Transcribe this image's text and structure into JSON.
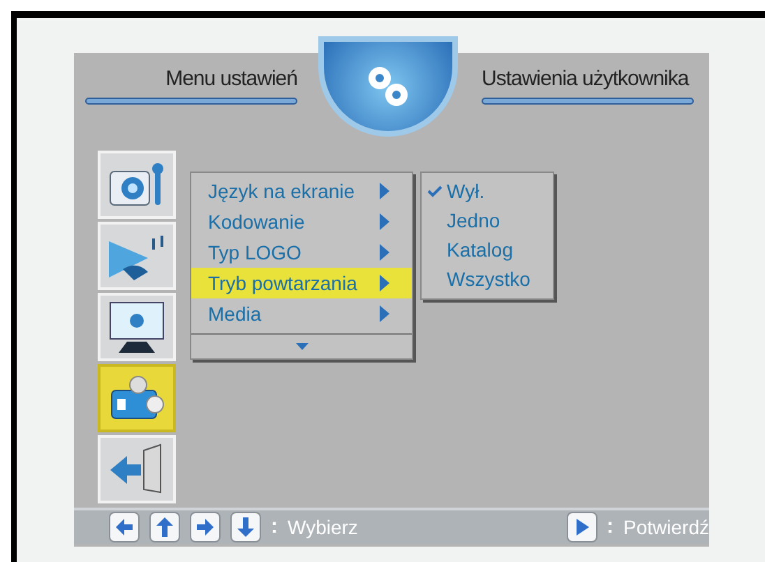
{
  "header": {
    "left_title": "Menu ustawień",
    "right_title": "Ustawienia użytkownika"
  },
  "sidebar": {
    "items": [
      {
        "kind": "camera",
        "selected": false
      },
      {
        "kind": "speaker",
        "selected": false
      },
      {
        "kind": "monitor",
        "selected": false
      },
      {
        "kind": "toolbox",
        "selected": true
      },
      {
        "kind": "exit",
        "selected": false
      }
    ]
  },
  "menu": {
    "items": [
      {
        "label": "Język na ekranie",
        "selected": false
      },
      {
        "label": "Kodowanie",
        "selected": false
      },
      {
        "label": "Typ LOGO",
        "selected": false
      },
      {
        "label": "Tryb powtarzania",
        "selected": true
      },
      {
        "label": "Media",
        "selected": false
      }
    ]
  },
  "submenu": {
    "items": [
      {
        "label": "Wył.",
        "checked": true
      },
      {
        "label": "Jedno",
        "checked": false
      },
      {
        "label": "Katalog",
        "checked": false
      },
      {
        "label": "Wszystko",
        "checked": false
      }
    ]
  },
  "footer": {
    "hints": [
      {
        "keys": [
          {
            "kind": "left"
          },
          {
            "kind": "up"
          },
          {
            "kind": "right"
          },
          {
            "kind": "down"
          }
        ],
        "separator": ":",
        "label": "Wybierz"
      },
      {
        "keys": [
          {
            "kind": "play"
          }
        ],
        "separator": ":",
        "label": "Potwierdź"
      }
    ]
  }
}
